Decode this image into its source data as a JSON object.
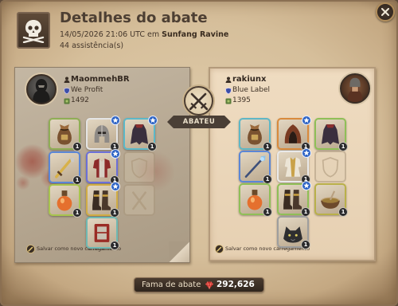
{
  "header": {
    "icon": "skull-crossbones-icon",
    "title": "Detalhes do abate",
    "datetime": "14/05/2026 21:06 UTC em",
    "location": "Sunfang Ravine",
    "assists": "44 assistência(s)"
  },
  "close_icon": "close-icon",
  "kill_icon": "crossed-swords-icon",
  "kill_label": "ABATEU",
  "killer": {
    "name": "MaommehBR",
    "guild": "We Profit",
    "item_power": "1492",
    "save_label": "Salvar como novo carregamento",
    "items": [
      {
        "icon": "bag-icon",
        "frame": "#8fae55",
        "count": "1"
      },
      {
        "icon": "helmet-icon",
        "frame": "#e4e4e4",
        "count": "1",
        "star": true
      },
      {
        "icon": "cape-icon",
        "frame": "#5cb8c8",
        "count": "1",
        "star": true
      },
      {
        "icon": "sword-icon",
        "frame": "#5b86d6",
        "count": "1"
      },
      {
        "icon": "armor-icon",
        "frame": "#6c70d8",
        "count": "1",
        "star": true
      },
      {
        "icon": "offhand-slot-icon",
        "empty": true
      },
      {
        "icon": "potion-icon",
        "frame": "#a8c44e",
        "count": "1"
      },
      {
        "icon": "boots-icon",
        "frame": "#d1ad45",
        "count": "1",
        "star": true
      },
      {
        "icon": "food-slot-icon",
        "empty": true
      },
      {
        "icon": "mount-icon",
        "frame": "#6fb9b3",
        "count": "1"
      }
    ]
  },
  "victim": {
    "name": "rakiunx",
    "guild": "Blue Label",
    "item_power": "1395",
    "save_label": "Salvar como novo carregamento",
    "items": [
      {
        "icon": "bag-icon",
        "frame": "#5fb7c6",
        "count": "1"
      },
      {
        "icon": "hood-icon",
        "frame": "#d98a3c",
        "count": "1",
        "star": true
      },
      {
        "icon": "cape-icon",
        "frame": "#8fbf57",
        "count": "1"
      },
      {
        "icon": "staff-icon",
        "frame": "#5b86d6",
        "count": "1"
      },
      {
        "icon": "robe-icon",
        "frame": "#e9e9e9",
        "count": "1",
        "star": true
      },
      {
        "icon": "offhand-slot-icon",
        "empty": true
      },
      {
        "icon": "potion-icon",
        "frame": "#8fbf57",
        "count": "1"
      },
      {
        "icon": "boots-icon",
        "frame": "#8fbf57",
        "count": "1",
        "star": true
      },
      {
        "icon": "soup-icon",
        "frame": "#b9b04a",
        "count": "1"
      },
      {
        "icon": "wolf-icon",
        "frame": "#9e9e9e",
        "count": "1"
      }
    ]
  },
  "fame": {
    "icon": "fame-gem-icon",
    "label": "Fama de abate",
    "value": "292,626"
  }
}
